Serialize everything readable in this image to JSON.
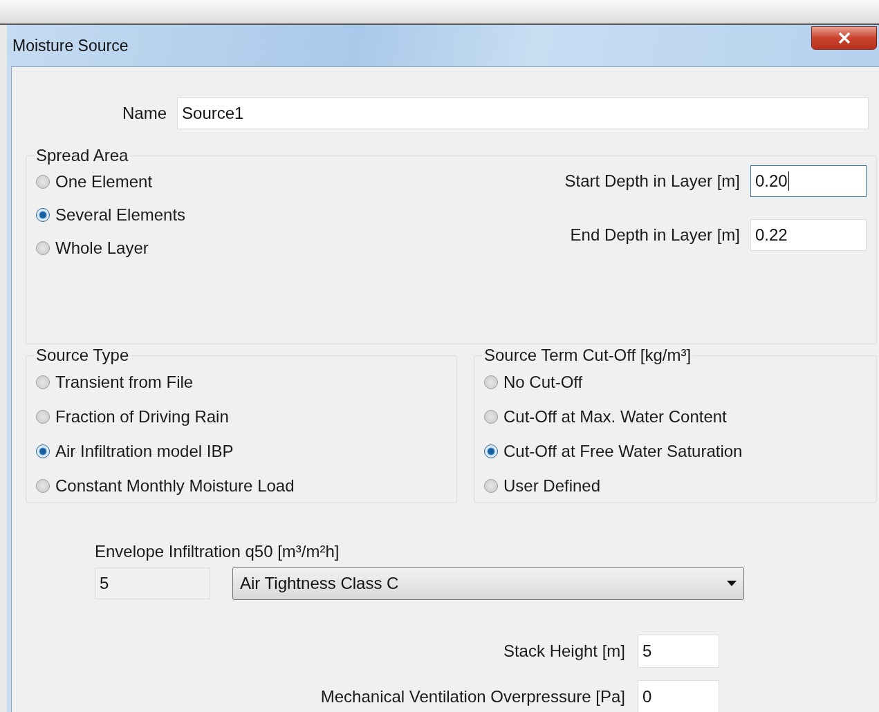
{
  "window": {
    "title": "Moisture Source"
  },
  "name_field": {
    "label": "Name",
    "value": "Source1"
  },
  "spread_area": {
    "title": "Spread Area",
    "options": [
      {
        "label": "One Element",
        "selected": false
      },
      {
        "label": "Several Elements",
        "selected": true
      },
      {
        "label": "Whole Layer",
        "selected": false
      }
    ],
    "fields": [
      {
        "label": "Start Depth in Layer [m]",
        "value": "0.20",
        "focused": true
      },
      {
        "label": "End Depth in Layer [m]",
        "value": "0.22",
        "focused": false
      }
    ]
  },
  "source_type": {
    "title": "Source Type",
    "options": [
      {
        "label": "Transient from File",
        "selected": false
      },
      {
        "label": "Fraction of Driving Rain",
        "selected": false
      },
      {
        "label": "Air Infiltration model IBP",
        "selected": true
      },
      {
        "label": "Constant Monthly Moisture Load",
        "selected": false
      }
    ]
  },
  "source_term_cutoff": {
    "title": "Source Term Cut-Off [kg/m³]",
    "options": [
      {
        "label": "No Cut-Off",
        "selected": false
      },
      {
        "label": "Cut-Off at Max. Water Content",
        "selected": false
      },
      {
        "label": "Cut-Off at Free Water Saturation",
        "selected": true
      },
      {
        "label": "User Defined",
        "selected": false
      }
    ]
  },
  "envelope_infiltration": {
    "label": "Envelope Infiltration q50 [m³/m²h]",
    "value": "5",
    "disabled": true,
    "class_select": "Air Tightness Class C"
  },
  "parameters": [
    {
      "label": "Stack Height [m]",
      "value": "5"
    },
    {
      "label": "Mechanical Ventilation Overpressure [Pa]",
      "value": "0"
    }
  ]
}
